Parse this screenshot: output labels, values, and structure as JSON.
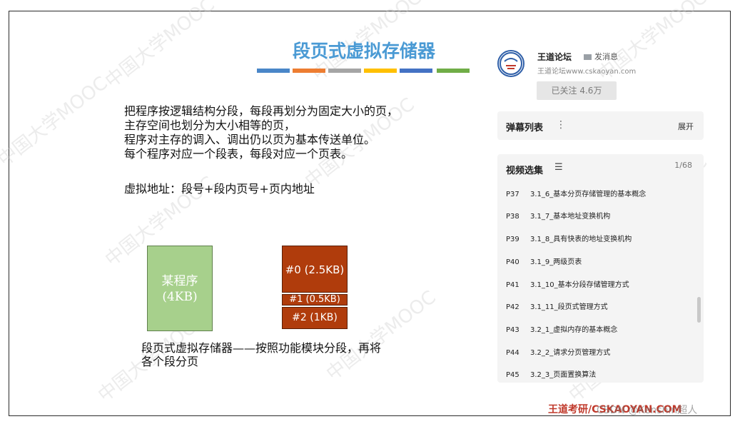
{
  "slide": {
    "title": "段页式虚拟存储器",
    "title_color": "#4a9ad4",
    "color_bars": [
      "#4a86c8",
      "#ed7d31",
      "#a5a5a5",
      "#ffc000",
      "#4472c4",
      "#70ad47"
    ],
    "body_lines": [
      "把程序按逻辑结构分段，每段再划分为固定大小的页，",
      "主存空间也划分为大小相等的页，",
      "程序对主存的调入、调出仍以页为基本传送单位。",
      "每个程序对应一个段表，每段对应一个页表。"
    ],
    "virtual_address": "虚拟地址：段号+段内页号+页内地址",
    "program_box": {
      "line1": "某程序",
      "line2": "(4KB)"
    },
    "segments": [
      "#0 (2.5KB)",
      "#1 (0.5KB)",
      "#2 (1KB)"
    ],
    "caption": "段页式虚拟存储器——按照功能模块分段，再将各个段分页",
    "brand": "王道考研/CSKAOYAN.COM",
    "csdn": "CSDN @Kenshin超人",
    "watermark": "中国大学MOOC"
  },
  "channel": {
    "name": "王道论坛",
    "message_label": "发消息",
    "url": "王道论坛www.cskaoyan.com",
    "follow_label": "已关注 4.6万"
  },
  "danmaku": {
    "title": "弹幕列表",
    "expand_label": "展开"
  },
  "video_list": {
    "title": "视频选集",
    "count": "1/68",
    "episodes": [
      {
        "code": "P37",
        "title": "3.1_6_基本分页存储管理的基本概念"
      },
      {
        "code": "P38",
        "title": "3.1_7_基本地址变换机构"
      },
      {
        "code": "P39",
        "title": "3.1_8_具有快表的地址变换机构"
      },
      {
        "code": "P40",
        "title": "3.1_9_两级页表"
      },
      {
        "code": "P41",
        "title": "3.1_10_基本分段存储管理方式"
      },
      {
        "code": "P42",
        "title": "3.1_11_段页式管理方式"
      },
      {
        "code": "P43",
        "title": "3.2_1_虚拟内存的基本概念"
      },
      {
        "code": "P44",
        "title": "3.2_2_请求分页管理方式"
      },
      {
        "code": "P45",
        "title": "3.2_3_页面置换算法"
      }
    ]
  }
}
